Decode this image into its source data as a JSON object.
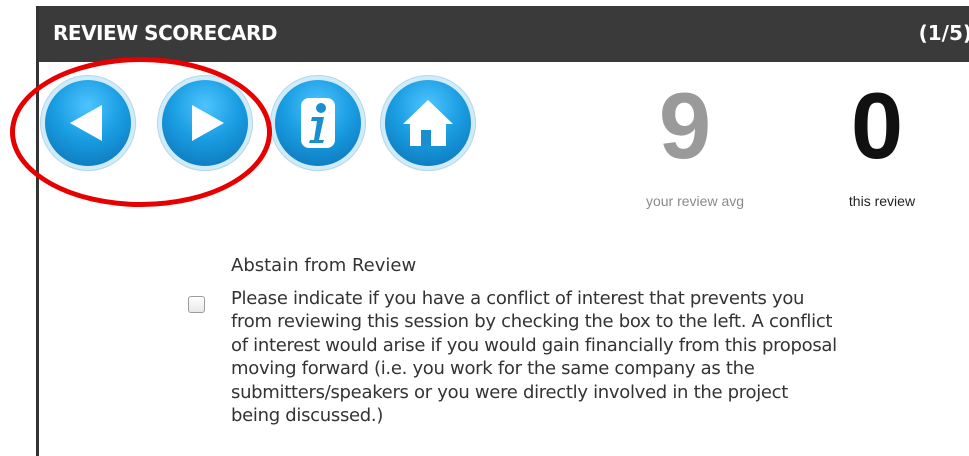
{
  "header": {
    "title": "REVIEW SCORECARD",
    "counter": "(1/5)"
  },
  "nav": {
    "prev_icon": "left-arrow-icon",
    "next_icon": "right-arrow-icon",
    "info_icon": "info-icon",
    "home_icon": "home-icon",
    "button_color": "#1a9de2",
    "highlight_color": "#e60000"
  },
  "scores": {
    "your_review_avg": "9",
    "your_review_avg_label": "your review avg",
    "this_review": "0",
    "this_review_label": "this review"
  },
  "abstain": {
    "title": "Abstain from Review",
    "checked": false,
    "description": "Please indicate if you have a conflict of interest that prevents you\nfrom reviewing this session by checking the box to the left. A conflict\nof interest would arise if you would gain financially from this proposal\nmoving forward (i.e. you work for the same company as the\nsubmitters/speakers or you were directly involved in the project\nbeing discussed.)"
  }
}
